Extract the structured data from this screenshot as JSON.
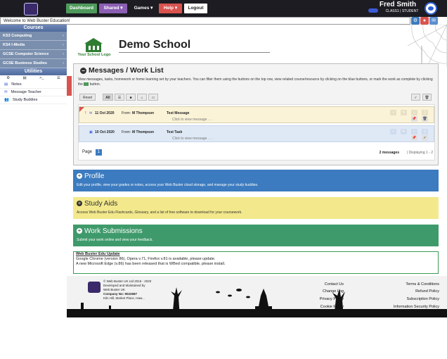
{
  "topbar": {
    "nav": [
      "Dashboard",
      "Shared ▾",
      "Games ▾",
      "Help ▾",
      "Logout"
    ],
    "user_name": "Fred Smith",
    "user_class": "CLASS1 | STUDENT"
  },
  "welcome": "Welcome to Web Buster Education!",
  "sidebar": {
    "courses_title": "Courses",
    "courses": [
      "KS3 Computing",
      "KS4 I-Media",
      "GCSE Computer Science",
      "GCSE Business Studies"
    ],
    "utilities_title": "Utilities",
    "utility_icons": [
      "gear-icon",
      "document-icon",
      "terminal-icon",
      "list-icon"
    ],
    "links": [
      "Notes",
      "Message Teacher",
      "Study Buddies"
    ]
  },
  "school": {
    "logo_text": "Your School Logo",
    "name": "Demo School"
  },
  "messages": {
    "title": "Messages / Work List",
    "description_1": "View messages, tasks, homework or home learning set by your teachers. You can filter them using the buttons on the top row, view related course/resource by clicking on the blue buttons, or mark the",
    "description_2": "work as complete by clicking the",
    "description_3": "button.",
    "toolbar": {
      "reset": "Reset",
      "all": "All"
    },
    "rows": [
      {
        "date": "11 Oct 2020",
        "from_label": "From:",
        "from": "M Thompson",
        "subject": "Test Message",
        "hint": "Click to view message . . ."
      },
      {
        "date": "10 Oct 2020",
        "from_label": "From:",
        "from": "M Thompson",
        "subject": "Test Task",
        "hint": "Click to view message . . ."
      }
    ],
    "page_label": "Page",
    "page_number": "1",
    "count_text": "2 messages",
    "display_text": "| Displaying 1 - 2"
  },
  "banners": [
    {
      "title": "Profile",
      "desc": "Edit your profile, view your grades or notes, access your Web Buster cloud storage, and manage your study buddies.",
      "color": "#3c7bbf"
    },
    {
      "title": "Study Aids",
      "desc": "Access Web Buster Edu Flashcards, Glossary, and a list of free software to download for your coursework.",
      "color": "#f3e98c"
    },
    {
      "title": "Work Submissions",
      "desc": "Submit your work online and view your feedback.",
      "color": "#3f9a6b"
    }
  ],
  "updates": {
    "title": "Web Buster Edu Update",
    "line1": "Google Chrome (version 86), Opera v.71, Firefox v.81 is available, please update.",
    "line2": "A new Microsoft Edge (v.86) has been released that is WBed compatible, please install."
  },
  "footer": {
    "copyright": "© Web Buster UK Ltd 2016 - 2020",
    "maintained": "Developed and Maintained by",
    "company": "Web Buster UK",
    "company_no": "Company No: 9022687",
    "address": "Kiln Hill, Market Place, Haw...",
    "links_mid": [
      "Contact Us",
      "Change Log",
      "Privacy Policy",
      "Cookie Policy"
    ],
    "links_right": [
      "Terms & Conditions",
      "Refund Policy",
      "Subscription Policy",
      "Information Security Policy"
    ]
  },
  "colors": {
    "dashboard": "#4e9a5c",
    "shared": "#8b5fb3",
    "help": "#d9534f",
    "accent": "#3b5bd6"
  }
}
